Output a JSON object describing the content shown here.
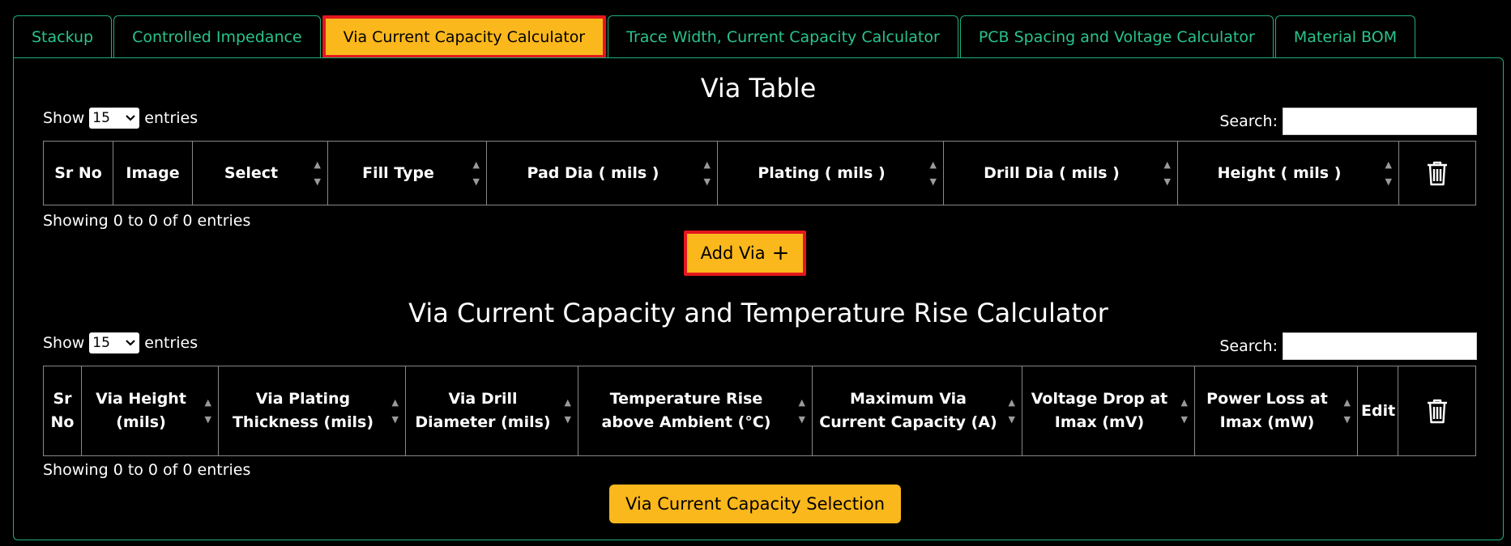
{
  "tabs": [
    {
      "label": "Stackup",
      "active": false
    },
    {
      "label": "Controlled Impedance",
      "active": false
    },
    {
      "label": "Via Current Capacity Calculator",
      "active": true
    },
    {
      "label": "Trace Width, Current Capacity Calculator",
      "active": false
    },
    {
      "label": "PCB Spacing and Voltage Calculator",
      "active": false
    },
    {
      "label": "Material BOM",
      "active": false
    }
  ],
  "via_table": {
    "title": "Via Table",
    "show_label": "Show",
    "entries_value": "15",
    "entries_label": "entries",
    "search_label": "Search:",
    "columns": [
      "Sr No",
      "Image",
      "Select",
      "Fill Type",
      "Pad Dia ( mils )",
      "Plating ( mils )",
      "Drill Dia ( mils )",
      "Height ( mils )"
    ],
    "info": "Showing 0 to 0 of 0 entries",
    "add_button": "Add Via",
    "add_icon": "+"
  },
  "calc_table": {
    "title": "Via Current Capacity and Temperature Rise Calculator",
    "show_label": "Show",
    "entries_value": "15",
    "entries_label": "entries",
    "search_label": "Search:",
    "columns": [
      "Sr No",
      "Via Height (mils)",
      "Via Plating Thickness (mils)",
      "Via Drill Diameter (mils)",
      "Temperature Rise above Ambient (°C)",
      "Maximum Via Current Capacity (A)",
      "Voltage Drop at Imax (mV)",
      "Power Loss at Imax (mW)",
      "Edit"
    ],
    "info": "Showing 0 to 0 of 0 entries",
    "selection_button": "Via Current Capacity Selection"
  },
  "colors": {
    "accent": "#fbb81c",
    "highlight_border": "#e3171d",
    "tab_text": "#29c48c",
    "border": "#1fae7c"
  }
}
